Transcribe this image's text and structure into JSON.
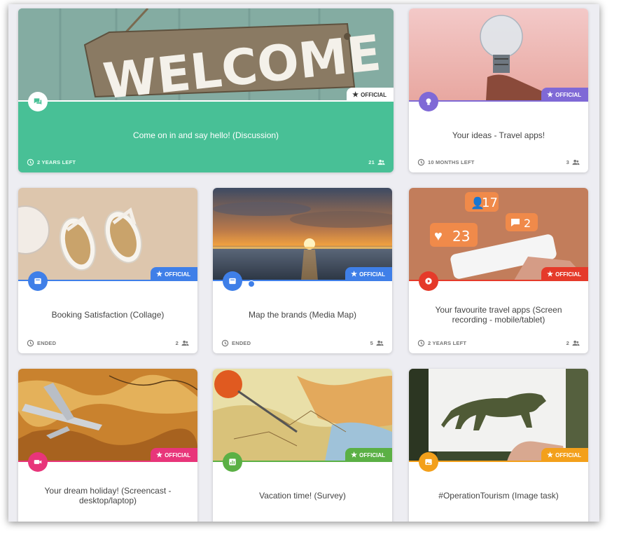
{
  "colors": {
    "background": "#ededf2",
    "welcome_green": "#48c096",
    "purple": "#7f69d6",
    "blue": "#3f7fe8",
    "red": "#e53a2a",
    "pink": "#e8357a",
    "green": "#5bb045",
    "orange": "#f3a01b"
  },
  "cards": [
    {
      "title": "Come on in and say hello! (Discussion)",
      "badge": "OFFICIAL",
      "time": "2 YEARS LEFT",
      "participants": "21",
      "type_icon": "discussion-icon",
      "image_text": "WELCOME"
    },
    {
      "title": "Your ideas - Travel apps!",
      "badge": "OFFICIAL",
      "time": "10 MONTHS LEFT",
      "participants": "3",
      "type_icon": "idea-icon"
    },
    {
      "title": "Booking Satisfaction (Collage)",
      "badge": "OFFICIAL",
      "time": "ENDED",
      "participants": "2",
      "type_icon": "collage-icon"
    },
    {
      "title": "Map the brands (Media Map)",
      "badge": "OFFICIAL",
      "time": "ENDED",
      "participants": "5",
      "type_icon": "media-map-icon"
    },
    {
      "title": "Your favourite travel apps (Screen recording - mobile/tablet)",
      "badge": "OFFICIAL",
      "time": "2 YEARS LEFT",
      "participants": "2",
      "type_icon": "screen-recording-icon",
      "image_text": {
        "followers": "17",
        "likes": "23",
        "comments": "2"
      }
    },
    {
      "title": "Your dream holiday! (Screencast - desktop/laptop)",
      "badge": "OFFICIAL",
      "time": "",
      "participants": "",
      "type_icon": "screencast-icon"
    },
    {
      "title": "Vacation time! (Survey)",
      "badge": "OFFICIAL",
      "time": "",
      "participants": "",
      "type_icon": "survey-icon"
    },
    {
      "title": "#OperationTourism (Image task)",
      "badge": "OFFICIAL",
      "time": "",
      "participants": "",
      "type_icon": "image-task-icon"
    }
  ]
}
